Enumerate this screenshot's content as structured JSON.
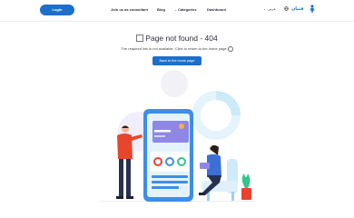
{
  "header": {
    "login_label": "Login",
    "nav": {
      "join": "Join us as consultant",
      "blog": "Blog",
      "categories": "Categories",
      "dashboard": "Dashboard"
    },
    "language": "عربي",
    "logo_text": "فنيان"
  },
  "main": {
    "title": "Page not found - 404",
    "subtitle": "The required link is not available. Click to return to the home page",
    "home_button": "Back to the home page"
  },
  "icons": [
    "broken-image-icon",
    "smile-icon",
    "globe-icon",
    "chevron-down-icon",
    "logo-mark-icon"
  ],
  "colors": {
    "primary": "#1d6fc9",
    "illustration_blue": "#3d8ee6",
    "illustration_light": "#dff0fb",
    "person_red": "#e8452c"
  }
}
